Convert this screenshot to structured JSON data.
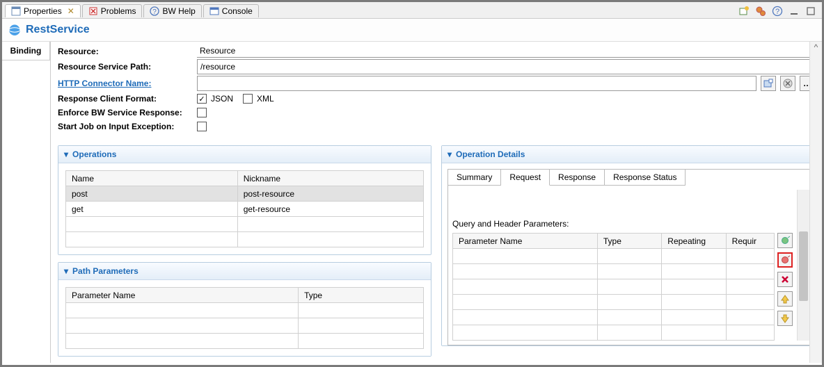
{
  "tabs": {
    "properties": "Properties",
    "problems": "Problems",
    "bwhelp": "BW Help",
    "console": "Console"
  },
  "header": {
    "title": "RestService"
  },
  "binding_tab": "Binding",
  "form": {
    "resource_label": "Resource:",
    "resource_value": "Resource",
    "resource_path_label": "Resource Service Path:",
    "resource_path_value": "/resource",
    "http_connector_label": "HTTP Connector Name:",
    "http_connector_value": "",
    "response_format_label": "Response Client Format:",
    "json_label": "JSON",
    "xml_label": "XML",
    "json_checked": true,
    "xml_checked": false,
    "enforce_label": "Enforce BW Service Response:",
    "startjob_label": "Start Job on Input Exception:"
  },
  "sections": {
    "operations": "Operations",
    "path_params": "Path Parameters",
    "op_details": "Operation Details"
  },
  "operations_table": {
    "cols": {
      "name": "Name",
      "nickname": "Nickname"
    },
    "rows": [
      {
        "name": "post",
        "nickname": "post-resource",
        "selected": true
      },
      {
        "name": "get",
        "nickname": "get-resource",
        "selected": false
      }
    ]
  },
  "path_params_table": {
    "cols": {
      "param": "Parameter Name",
      "type": "Type"
    }
  },
  "op_detail_tabs": {
    "summary": "Summary",
    "request": "Request",
    "response": "Response",
    "response_status": "Response Status",
    "active": "request"
  },
  "query_header_label": "Query and Header Parameters:",
  "query_table": {
    "cols": {
      "param": "Parameter Name",
      "type": "Type",
      "repeating": "Repeating",
      "required": "Requir"
    }
  }
}
